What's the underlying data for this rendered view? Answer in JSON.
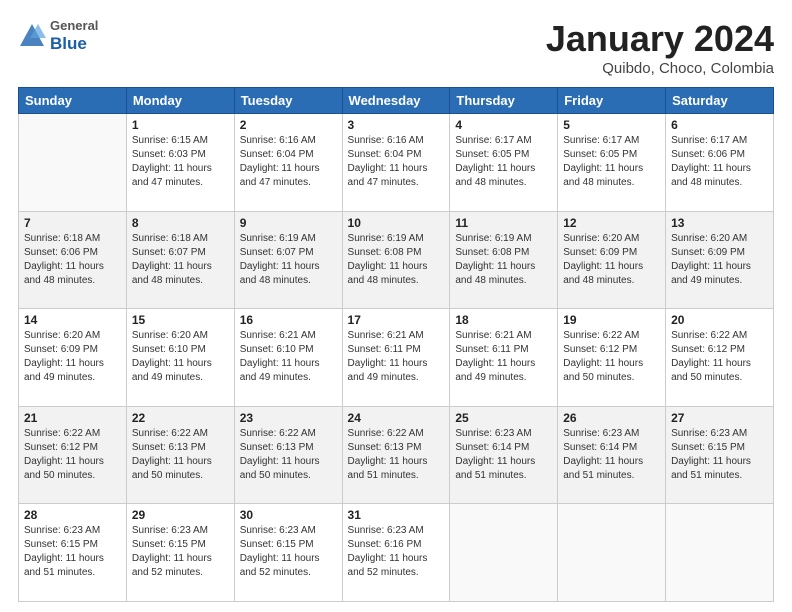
{
  "header": {
    "logo_general": "General",
    "logo_blue": "Blue",
    "month": "January 2024",
    "location": "Quibdo, Choco, Colombia"
  },
  "days_of_week": [
    "Sunday",
    "Monday",
    "Tuesday",
    "Wednesday",
    "Thursday",
    "Friday",
    "Saturday"
  ],
  "weeks": [
    [
      {
        "day": "",
        "info": ""
      },
      {
        "day": "1",
        "info": "Sunrise: 6:15 AM\nSunset: 6:03 PM\nDaylight: 11 hours\nand 47 minutes."
      },
      {
        "day": "2",
        "info": "Sunrise: 6:16 AM\nSunset: 6:04 PM\nDaylight: 11 hours\nand 47 minutes."
      },
      {
        "day": "3",
        "info": "Sunrise: 6:16 AM\nSunset: 6:04 PM\nDaylight: 11 hours\nand 47 minutes."
      },
      {
        "day": "4",
        "info": "Sunrise: 6:17 AM\nSunset: 6:05 PM\nDaylight: 11 hours\nand 48 minutes."
      },
      {
        "day": "5",
        "info": "Sunrise: 6:17 AM\nSunset: 6:05 PM\nDaylight: 11 hours\nand 48 minutes."
      },
      {
        "day": "6",
        "info": "Sunrise: 6:17 AM\nSunset: 6:06 PM\nDaylight: 11 hours\nand 48 minutes."
      }
    ],
    [
      {
        "day": "7",
        "info": "Sunrise: 6:18 AM\nSunset: 6:06 PM\nDaylight: 11 hours\nand 48 minutes."
      },
      {
        "day": "8",
        "info": "Sunrise: 6:18 AM\nSunset: 6:07 PM\nDaylight: 11 hours\nand 48 minutes."
      },
      {
        "day": "9",
        "info": "Sunrise: 6:19 AM\nSunset: 6:07 PM\nDaylight: 11 hours\nand 48 minutes."
      },
      {
        "day": "10",
        "info": "Sunrise: 6:19 AM\nSunset: 6:08 PM\nDaylight: 11 hours\nand 48 minutes."
      },
      {
        "day": "11",
        "info": "Sunrise: 6:19 AM\nSunset: 6:08 PM\nDaylight: 11 hours\nand 48 minutes."
      },
      {
        "day": "12",
        "info": "Sunrise: 6:20 AM\nSunset: 6:09 PM\nDaylight: 11 hours\nand 48 minutes."
      },
      {
        "day": "13",
        "info": "Sunrise: 6:20 AM\nSunset: 6:09 PM\nDaylight: 11 hours\nand 49 minutes."
      }
    ],
    [
      {
        "day": "14",
        "info": "Sunrise: 6:20 AM\nSunset: 6:09 PM\nDaylight: 11 hours\nand 49 minutes."
      },
      {
        "day": "15",
        "info": "Sunrise: 6:20 AM\nSunset: 6:10 PM\nDaylight: 11 hours\nand 49 minutes."
      },
      {
        "day": "16",
        "info": "Sunrise: 6:21 AM\nSunset: 6:10 PM\nDaylight: 11 hours\nand 49 minutes."
      },
      {
        "day": "17",
        "info": "Sunrise: 6:21 AM\nSunset: 6:11 PM\nDaylight: 11 hours\nand 49 minutes."
      },
      {
        "day": "18",
        "info": "Sunrise: 6:21 AM\nSunset: 6:11 PM\nDaylight: 11 hours\nand 49 minutes."
      },
      {
        "day": "19",
        "info": "Sunrise: 6:22 AM\nSunset: 6:12 PM\nDaylight: 11 hours\nand 50 minutes."
      },
      {
        "day": "20",
        "info": "Sunrise: 6:22 AM\nSunset: 6:12 PM\nDaylight: 11 hours\nand 50 minutes."
      }
    ],
    [
      {
        "day": "21",
        "info": "Sunrise: 6:22 AM\nSunset: 6:12 PM\nDaylight: 11 hours\nand 50 minutes."
      },
      {
        "day": "22",
        "info": "Sunrise: 6:22 AM\nSunset: 6:13 PM\nDaylight: 11 hours\nand 50 minutes."
      },
      {
        "day": "23",
        "info": "Sunrise: 6:22 AM\nSunset: 6:13 PM\nDaylight: 11 hours\nand 50 minutes."
      },
      {
        "day": "24",
        "info": "Sunrise: 6:22 AM\nSunset: 6:13 PM\nDaylight: 11 hours\nand 51 minutes."
      },
      {
        "day": "25",
        "info": "Sunrise: 6:23 AM\nSunset: 6:14 PM\nDaylight: 11 hours\nand 51 minutes."
      },
      {
        "day": "26",
        "info": "Sunrise: 6:23 AM\nSunset: 6:14 PM\nDaylight: 11 hours\nand 51 minutes."
      },
      {
        "day": "27",
        "info": "Sunrise: 6:23 AM\nSunset: 6:15 PM\nDaylight: 11 hours\nand 51 minutes."
      }
    ],
    [
      {
        "day": "28",
        "info": "Sunrise: 6:23 AM\nSunset: 6:15 PM\nDaylight: 11 hours\nand 51 minutes."
      },
      {
        "day": "29",
        "info": "Sunrise: 6:23 AM\nSunset: 6:15 PM\nDaylight: 11 hours\nand 52 minutes."
      },
      {
        "day": "30",
        "info": "Sunrise: 6:23 AM\nSunset: 6:15 PM\nDaylight: 11 hours\nand 52 minutes."
      },
      {
        "day": "31",
        "info": "Sunrise: 6:23 AM\nSunset: 6:16 PM\nDaylight: 11 hours\nand 52 minutes."
      },
      {
        "day": "",
        "info": ""
      },
      {
        "day": "",
        "info": ""
      },
      {
        "day": "",
        "info": ""
      }
    ]
  ]
}
